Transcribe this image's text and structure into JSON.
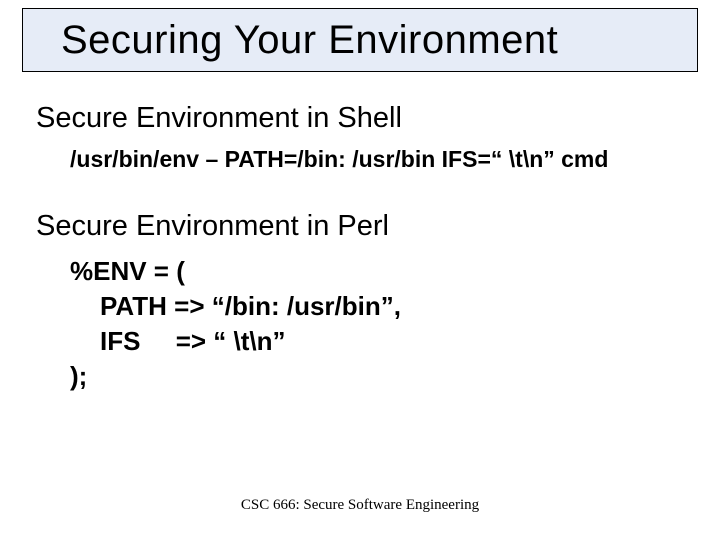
{
  "title": "Securing Your Environment",
  "section1": {
    "heading": "Secure Environment in Shell",
    "command": "/usr/bin/env – PATH=/bin: /usr/bin IFS=“ \\t\\n” cmd"
  },
  "section2": {
    "heading": "Secure Environment in Perl",
    "code": {
      "l1": "%ENV = (",
      "l2_key": "PATH",
      "l2_arrow": "=>",
      "l2_val": "“/bin: /usr/bin”,",
      "l3_key": "IFS",
      "l3_arrow": "=>",
      "l3_val": "“ \\t\\n”",
      "l4": ");"
    }
  },
  "footer": "CSC 666: Secure Software Engineering"
}
